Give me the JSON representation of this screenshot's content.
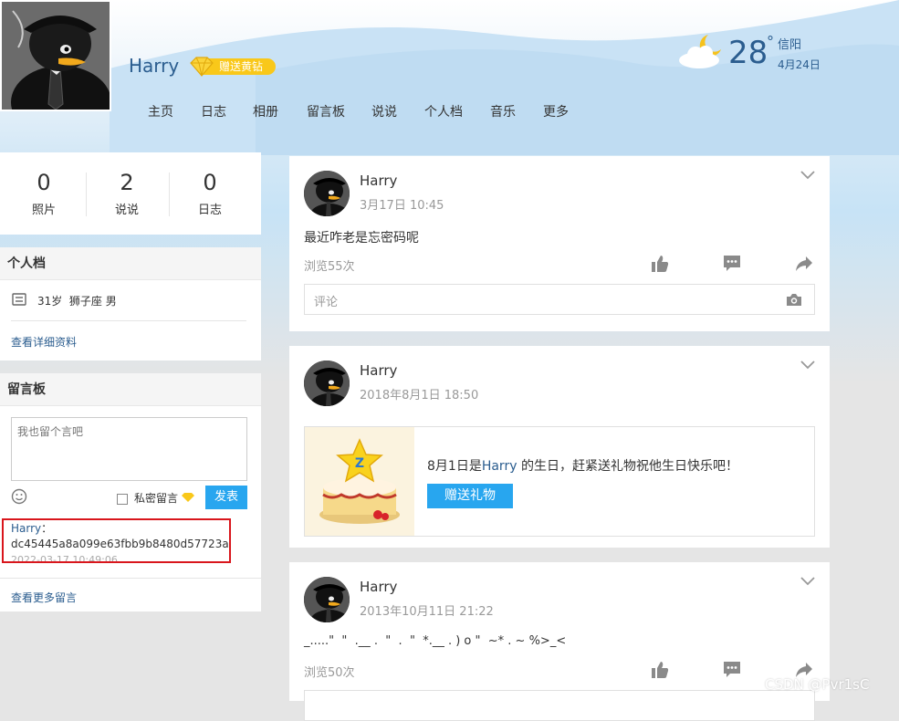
{
  "header": {
    "owner_name": "Harry",
    "gift_diamond_label": "赠送黄钻",
    "nav": [
      "主页",
      "日志",
      "相册",
      "留言板",
      "说说",
      "个人档",
      "音乐",
      "更多"
    ],
    "weather": {
      "temp": "28",
      "deg": "°",
      "city": "信阳",
      "date": "4月24日"
    }
  },
  "stats": [
    {
      "value": "0",
      "label": "照片"
    },
    {
      "value": "2",
      "label": "说说"
    },
    {
      "value": "0",
      "label": "日志"
    }
  ],
  "profile": {
    "title": "个人档",
    "info": "31岁  狮子座 男",
    "details_link": "查看详细资料"
  },
  "message_board": {
    "title": "留言板",
    "placeholder": "我也留个言吧",
    "private_label": "私密留言",
    "publish_button": "发表",
    "message": {
      "author": "Harry",
      "colon": "：",
      "content": "dc45445a8a099e63fbb9b8480d57723a",
      "time": "2022-03-17 10:49:06"
    },
    "more_link": "查看更多留言"
  },
  "posts": [
    {
      "author": "Harry",
      "time": "3月17日 10:45",
      "text": "最近咋老是忘密码呢",
      "views": "浏览55次",
      "comment_placeholder": "评论"
    },
    {
      "author": "Harry",
      "time": "2018年8月1日 18:50",
      "birthday_prefix": "8月1日是",
      "birthday_name": "Harry",
      "birthday_suffix": " 的生日，赶紧送礼物祝他生日快乐吧！",
      "gift_button": "赠送礼物"
    },
    {
      "author": "Harry",
      "time": "2013年10月11日 21:22",
      "text": "_.....\"  \"  .__ .  \"  .  \"  *.__ . ) o \"  ~* . ~ %>_<",
      "views": "浏览50次"
    }
  ],
  "watermark": "CSDN @Pvr1sC",
  "colors": {
    "accent_blue": "#28a6ef",
    "link_blue": "#2b5d8f",
    "highlight_red": "#d9161c",
    "gold": "#f9c81a"
  }
}
